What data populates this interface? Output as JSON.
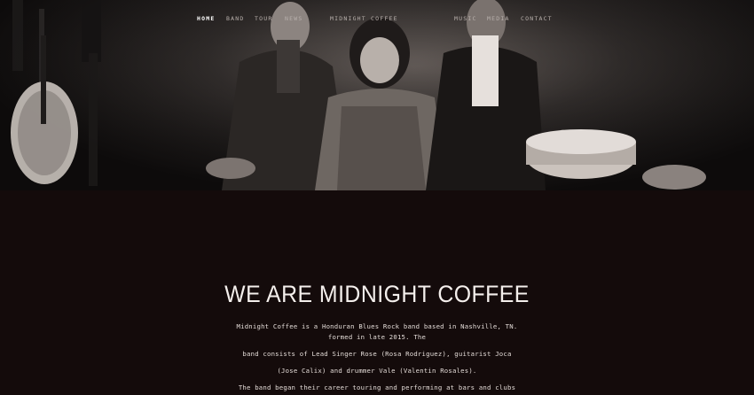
{
  "nav": {
    "left": [
      "HOME",
      "BAND",
      "TOUR",
      "NEWS"
    ],
    "brand": "MIDNIGHT COFFEE",
    "right": [
      "MUSIC",
      "MEDIA",
      "CONTACT"
    ]
  },
  "about": {
    "heading": "WE ARE MIDNIGHT COFFEE",
    "lines": [
      "Midnight Coffee is a Honduran Blues Rock band based in Nashville, TN.",
      "formed in late 2015. The",
      "band consists of Lead Singer Rose (Rosa Rodriguez), guitarist Joca",
      "(Jose Calix) and drummer Vale (Valentin Rosales).",
      "The band began their career touring and performing at bars and clubs"
    ]
  },
  "colors": {
    "background": "#140b0b",
    "brand": "#d8c9a8"
  }
}
